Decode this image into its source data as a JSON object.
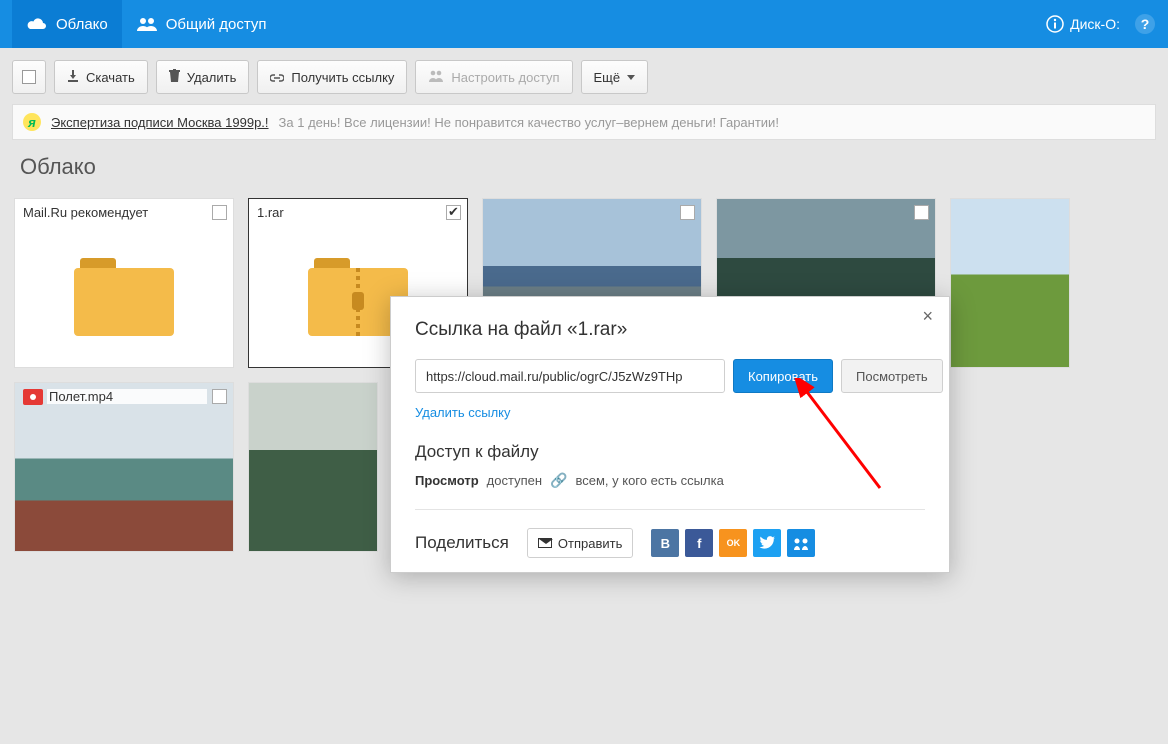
{
  "topbar": {
    "cloud_label": "Облако",
    "shared_label": "Общий доступ",
    "disko_label": "Диск-О:"
  },
  "toolbar": {
    "download": "Скачать",
    "delete": "Удалить",
    "get_link": "Получить ссылку",
    "configure_access": "Настроить доступ",
    "more": "Ещё"
  },
  "ad": {
    "link_text": "Экспертиза подписи Москва 1999р.!",
    "rest_text": "За 1 день! Все лицензии! Не понравится качество услуг–вернем деньги! Гарантии!"
  },
  "breadcrumb": "Облако",
  "files": [
    {
      "label": "Mail.Ru рекомендует",
      "type": "folder",
      "checked": false
    },
    {
      "label": "1.rar",
      "type": "archive",
      "checked": true
    },
    {
      "label": "",
      "type": "image",
      "checked": false
    },
    {
      "label": "",
      "type": "image",
      "checked": false
    },
    {
      "label": "",
      "type": "image",
      "checked": false
    },
    {
      "label": "Полет.mp4",
      "type": "video",
      "checked": false
    },
    {
      "label": "",
      "type": "image",
      "checked": false
    }
  ],
  "modal": {
    "title_prefix": "Ссылка на файл «",
    "title_file": "1.rar",
    "title_suffix": "»",
    "url": "https://cloud.mail.ru/public/ogrC/J5zWz9THp",
    "copy": "Копировать",
    "view": "Посмотреть",
    "delete_link": "Удалить ссылку",
    "access_title": "Доступ к файлу",
    "access_label_bold": "Просмотр",
    "access_label_rest": "доступен",
    "access_scope": "всем, у кого есть ссылка",
    "share_title": "Поделиться",
    "send_label": "Отправить",
    "social": {
      "vk": "B",
      "fb": "f",
      "ok": "OK",
      "tw": "",
      "mm": "@"
    },
    "close": "×"
  }
}
